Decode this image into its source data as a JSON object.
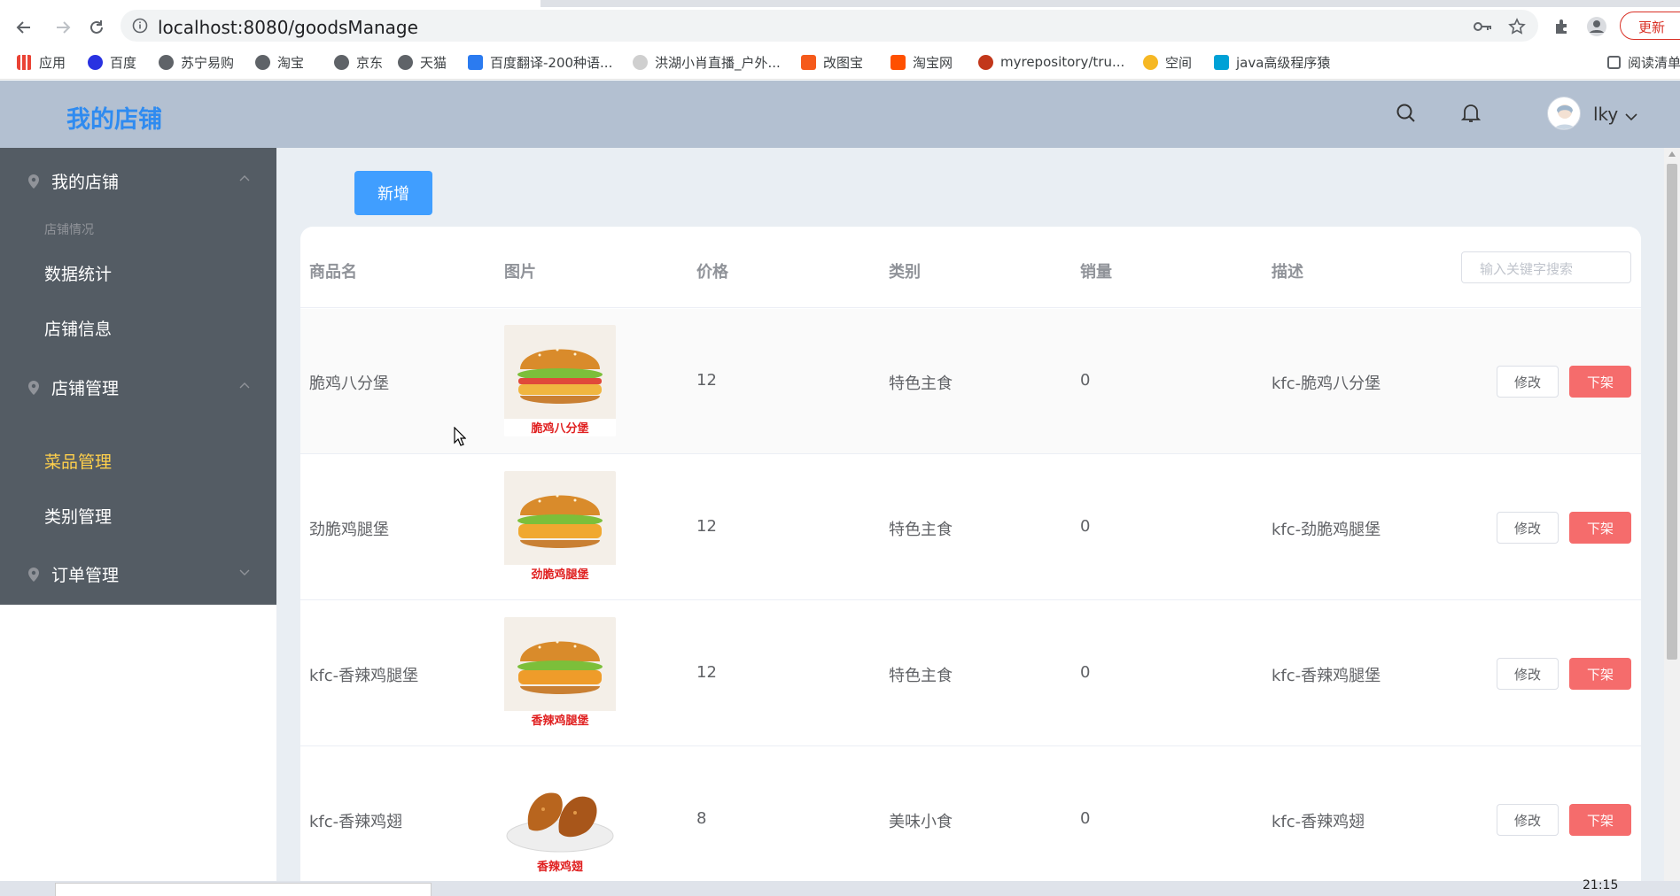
{
  "browser": {
    "url": "localhost:8080/goodsManage",
    "update_label": "更新",
    "bookmarks": [
      {
        "label": "应用",
        "icon": "apps-grid-icon",
        "color": "#4285f4"
      },
      {
        "label": "百度",
        "icon": "baidu-paw-icon",
        "color": "#2932e1"
      },
      {
        "label": "苏宁易购",
        "icon": "globe-icon",
        "color": "#5f6368"
      },
      {
        "label": "淘宝",
        "icon": "globe-icon",
        "color": "#5f6368"
      },
      {
        "label": "京东",
        "icon": "globe-icon",
        "color": "#5f6368"
      },
      {
        "label": "天猫",
        "icon": "globe-icon",
        "color": "#5f6368"
      },
      {
        "label": "百度翻译-200种语...",
        "icon": "translate-icon",
        "color": "#2b7bf0"
      },
      {
        "label": "洪湖小肖直播_户外...",
        "icon": "bird-icon",
        "color": "#888888"
      },
      {
        "label": "改图宝",
        "icon": "image-tool-icon",
        "color": "#f55a1b"
      },
      {
        "label": "淘宝网",
        "icon": "taobao-icon",
        "color": "#ff5000"
      },
      {
        "label": "myrepository/tru...",
        "icon": "repo-icon",
        "color": "#c2371a"
      },
      {
        "label": "空间",
        "icon": "qzone-icon",
        "color": "#f6b824"
      },
      {
        "label": "java高级程序猿",
        "icon": "bilibili-icon",
        "color": "#00a1d6"
      },
      {
        "label": "阅读清单",
        "icon": "reading-list-icon",
        "color": "#5f6368"
      }
    ]
  },
  "header": {
    "title": "我的店铺",
    "username": "lky"
  },
  "sidebar": {
    "menus": [
      {
        "label": "我的店铺",
        "group_title": "店铺情况",
        "items": [
          "数据统计",
          "店铺信息"
        ]
      },
      {
        "label": "店铺管理",
        "items": [
          "菜品管理",
          "类别管理"
        ],
        "active": "菜品管理"
      },
      {
        "label": "订单管理"
      }
    ]
  },
  "main": {
    "add_label": "新增",
    "search_placeholder": "输入关键字搜索",
    "columns": [
      "商品名",
      "图片",
      "价格",
      "类别",
      "销量",
      "描述"
    ],
    "edit_label": "修改",
    "off_label": "下架",
    "rows": [
      {
        "name": "脆鸡八分堡",
        "image_caption": "脆鸡八分堡",
        "image_kind": "burger",
        "price": "12",
        "category": "特色主食",
        "sales": "0",
        "desc": "kfc-脆鸡八分堡"
      },
      {
        "name": "劲脆鸡腿堡",
        "image_caption": "劲脆鸡腿堡",
        "image_kind": "burger",
        "price": "12",
        "category": "特色主食",
        "sales": "0",
        "desc": "kfc-劲脆鸡腿堡"
      },
      {
        "name": "kfc-香辣鸡腿堡",
        "image_caption": "香辣鸡腿堡",
        "image_kind": "burger",
        "price": "12",
        "category": "特色主食",
        "sales": "0",
        "desc": "kfc-香辣鸡腿堡"
      },
      {
        "name": "kfc-香辣鸡翅",
        "image_caption": "香辣鸡翅",
        "image_kind": "wings",
        "price": "8",
        "category": "美味小食",
        "sales": "0",
        "desc": "kfc-香辣鸡翅"
      }
    ]
  },
  "taskbar": {
    "clock": "21:15"
  },
  "colors": {
    "accent": "#409eff",
    "danger": "#f56c6c",
    "sidebar": "#545c64",
    "header": "#b3c0d1",
    "active_menu": "#ffd04b",
    "logo": "#2f8bf0"
  }
}
